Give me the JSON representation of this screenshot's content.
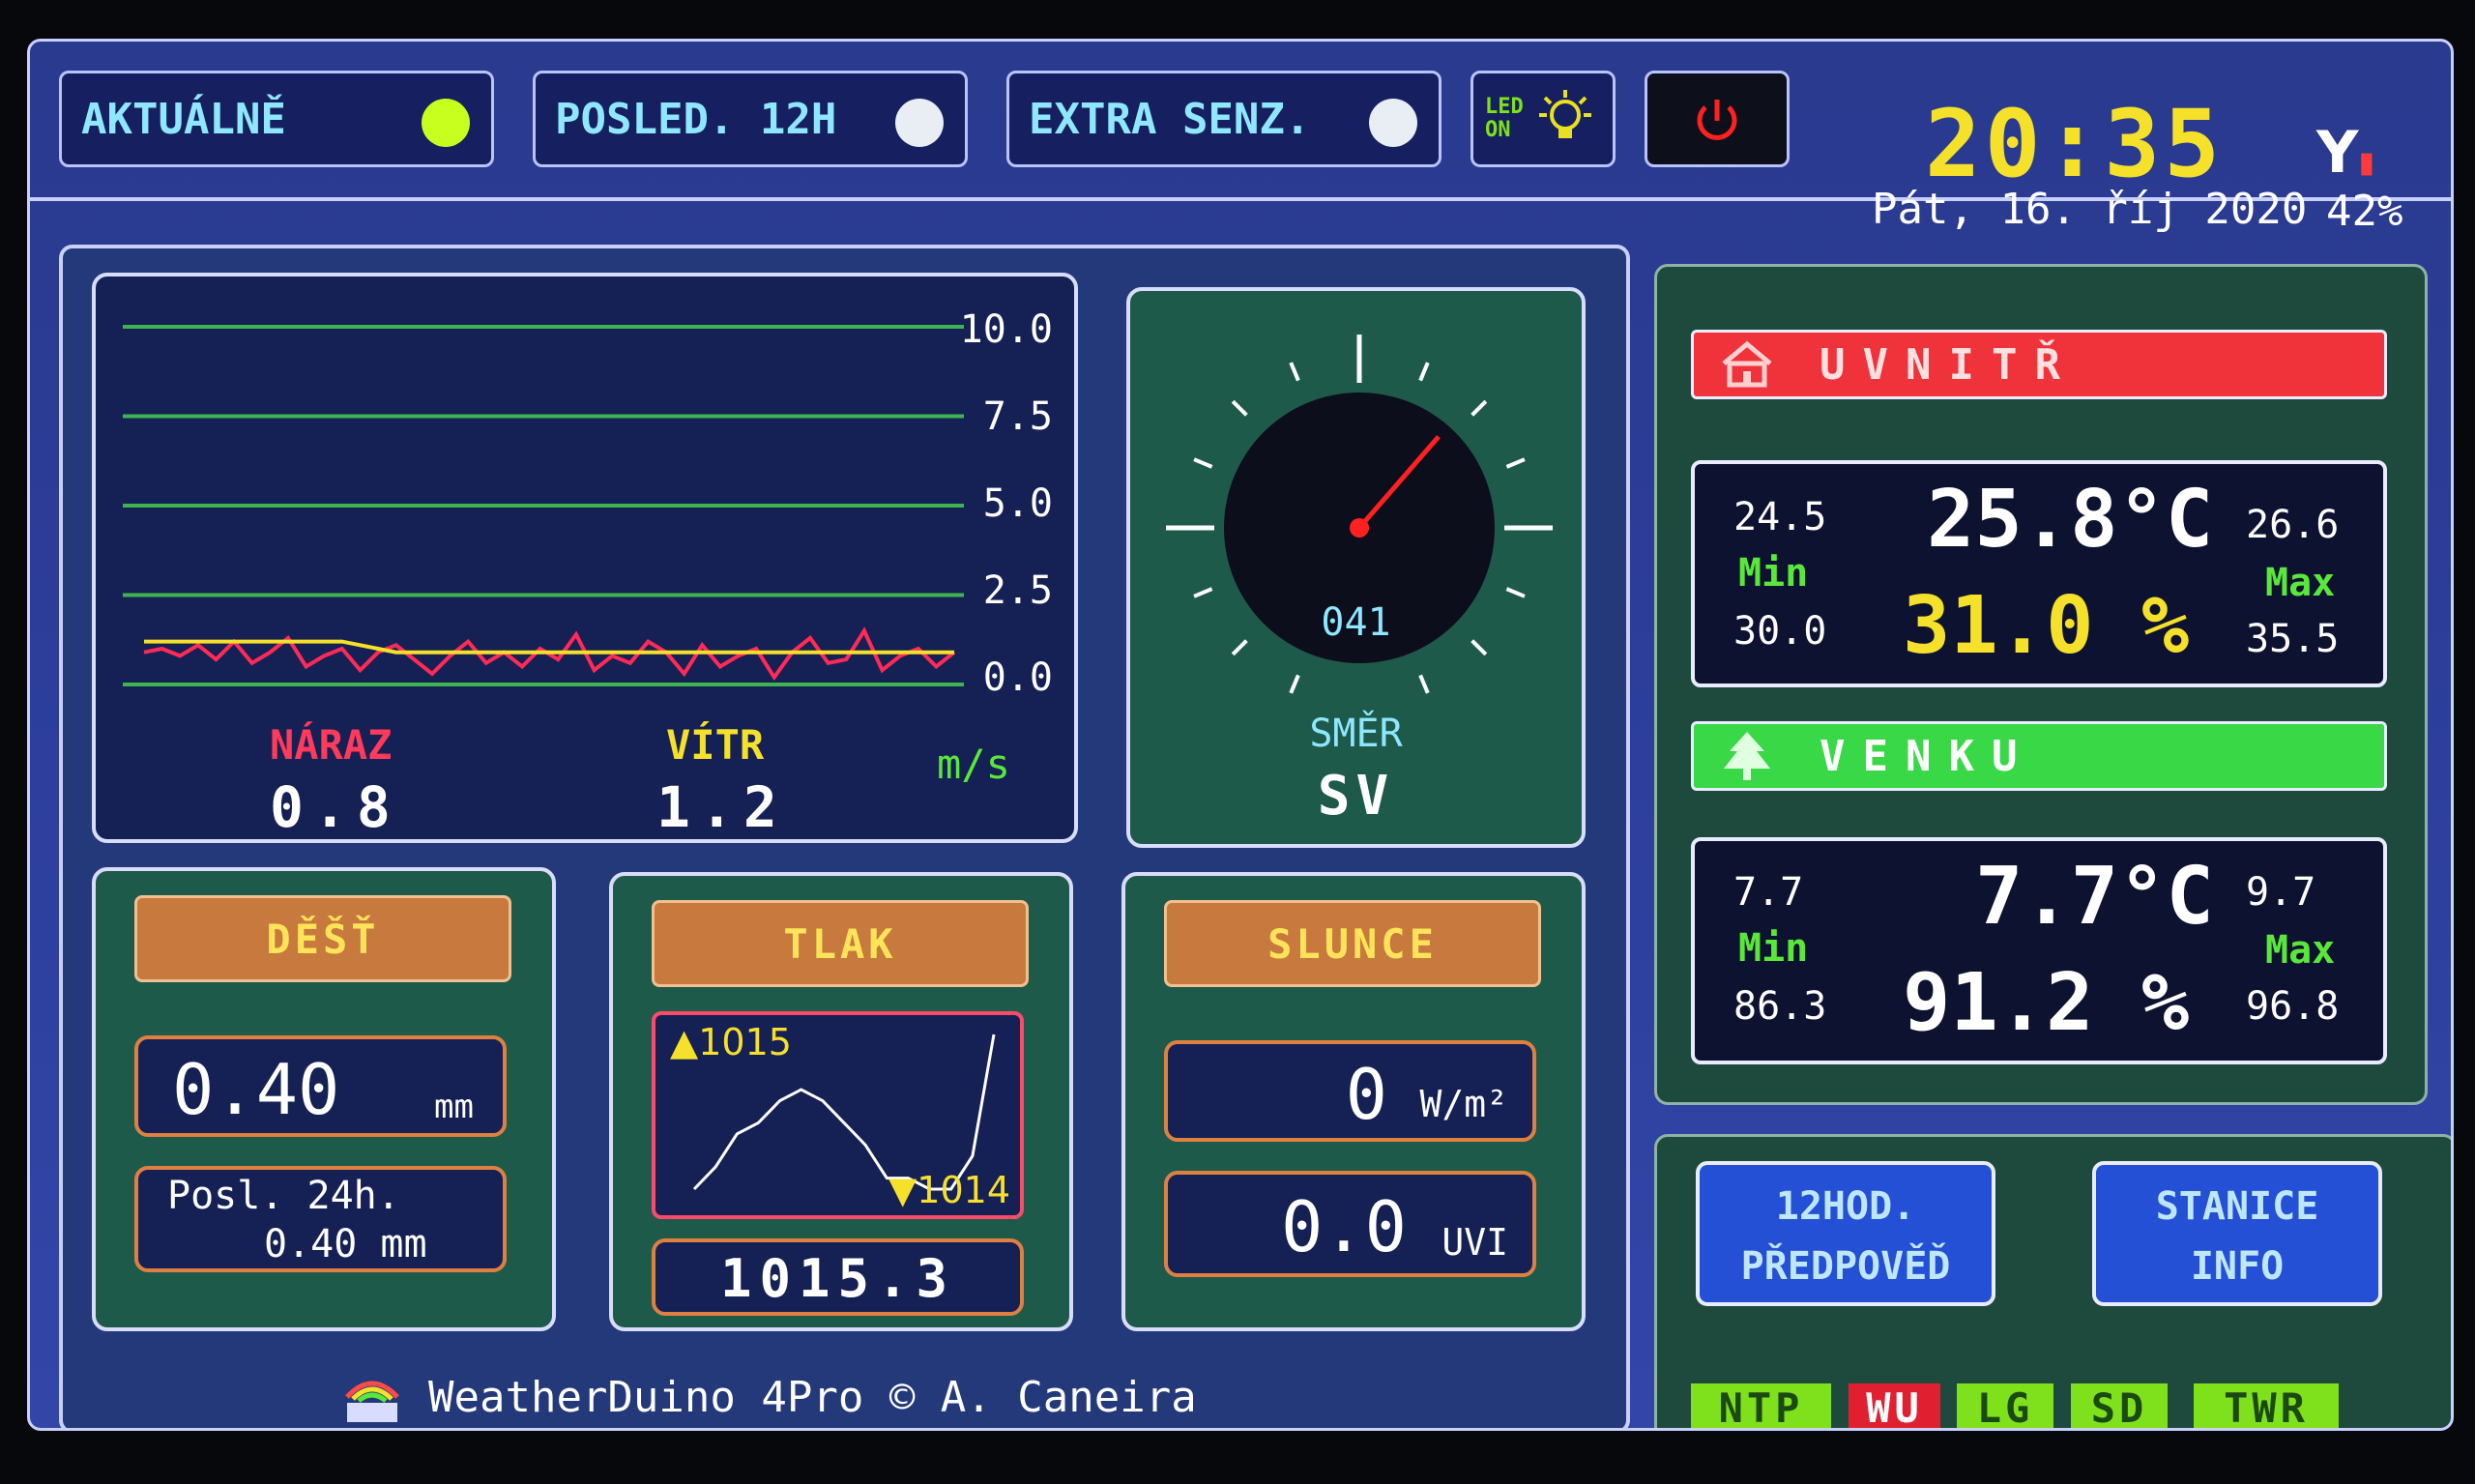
{
  "topbar": {
    "tabs": [
      {
        "label": "AKTUÁLNĚ",
        "dot_color": "#c8ff1e"
      },
      {
        "label": "POSLED. 12H",
        "dot_color": "#e8eef4"
      },
      {
        "label": "EXTRA SENZ.",
        "dot_color": "#e8eef4"
      }
    ],
    "led_label": "LED ON",
    "clock": "20:35",
    "date": "Pát, 16. říj 2020",
    "signal": "42%"
  },
  "wind": {
    "y_ticks": [
      "10.0",
      "7.5",
      "5.0",
      "2.5",
      "0.0"
    ],
    "gust_label": "NÁRAZ",
    "gust_value": "0.8",
    "wind_label": "VÍTR",
    "wind_value": "1.2",
    "unit": "m/s",
    "series_gust": [
      0.9,
      1.0,
      0.8,
      1.1,
      0.7,
      1.2,
      0.6,
      0.9,
      1.3,
      0.5,
      0.8,
      1.0,
      0.4,
      0.9,
      1.1,
      0.7,
      0.3,
      0.8,
      1.2,
      0.6,
      0.9,
      0.5,
      1.0,
      0.7,
      1.4,
      0.4,
      0.8,
      0.6,
      1.2,
      0.9,
      0.3,
      1.1,
      0.5,
      0.8,
      1.0,
      0.2,
      0.9,
      1.3,
      0.6,
      0.7,
      1.5,
      0.4,
      0.8,
      1.0,
      0.5,
      0.9
    ],
    "series_wind": [
      1.2,
      1.2,
      1.2,
      1.2,
      1.2,
      1.2,
      1.2,
      1.2,
      1.2,
      1.2,
      1.2,
      1.2,
      1.1,
      1.0,
      0.9,
      0.9,
      0.9,
      0.9,
      0.9,
      0.9,
      0.9,
      0.9,
      0.9,
      0.9,
      0.9,
      0.9,
      0.9,
      0.9,
      0.9,
      0.9,
      0.9,
      0.9,
      0.9,
      0.9,
      0.9,
      0.9,
      0.9,
      0.9,
      0.9,
      0.9,
      0.9,
      0.9,
      0.9,
      0.9,
      0.9,
      0.9
    ],
    "y_range": [
      0,
      10
    ],
    "colors": {
      "gust": "#ff2a55",
      "wind": "#f5e02a",
      "grid": "#3fb34f"
    }
  },
  "compass": {
    "degrees": "041",
    "direction_label": "SMĚR",
    "direction": "SV",
    "needle_deg": 41
  },
  "rain": {
    "title": "DĚŠŤ",
    "value": "0.40",
    "unit": "mm",
    "sub_line1": "Posl. 24h.",
    "sub_line2": "0.40 mm"
  },
  "pressure": {
    "title": "TLAK",
    "max_label": "▲1015",
    "min_label": "▼1014",
    "value": "1015.3",
    "trend": [
      1014.3,
      1014.4,
      1014.55,
      1014.6,
      1014.7,
      1014.75,
      1014.7,
      1014.6,
      1014.5,
      1014.35,
      1014.35,
      1014.3,
      1014.3,
      1014.45,
      1015.0
    ]
  },
  "sun": {
    "title": "SLUNCE",
    "radiation": "0",
    "radiation_unit": "W/m²",
    "uv": "0.0",
    "uv_unit": "UVI"
  },
  "indoor": {
    "title": "UVNITŘ",
    "color": "#f0323a",
    "min_temp": "24.5",
    "max_temp": "26.6",
    "temp": "25.8°C",
    "min_label": "Min",
    "max_label": "Max",
    "min_hum": "30.0",
    "max_hum": "35.5",
    "hum": "31.0 %"
  },
  "outdoor": {
    "title": "VENKU",
    "color": "#38d846",
    "min_temp": "7.7",
    "max_temp": "9.7",
    "temp": "7.7°C",
    "min_label": "Min",
    "max_label": "Max",
    "min_hum": "86.3",
    "max_hum": "96.8",
    "hum": "91.2 %"
  },
  "buttons": {
    "forecast_line1": "12HOD.",
    "forecast_line2": "PŘEDPOVĚĎ",
    "station_line1": "STANICE",
    "station_line2": "INFO"
  },
  "status_flags": [
    {
      "label": "NTP",
      "bg": "#7fe01c",
      "fg": "#1a4a12"
    },
    {
      "label": "WU",
      "bg": "#e02030",
      "fg": "#ffffff"
    },
    {
      "label": "LG",
      "bg": "#7fe01c",
      "fg": "#1a4a12"
    },
    {
      "label": "SD",
      "bg": "#7fe01c",
      "fg": "#1a4a12"
    },
    {
      "label": "TWR",
      "bg": "#7fe01c",
      "fg": "#1a4a12"
    }
  ],
  "footer": "WeatherDuino 4Pro © A. Caneira"
}
